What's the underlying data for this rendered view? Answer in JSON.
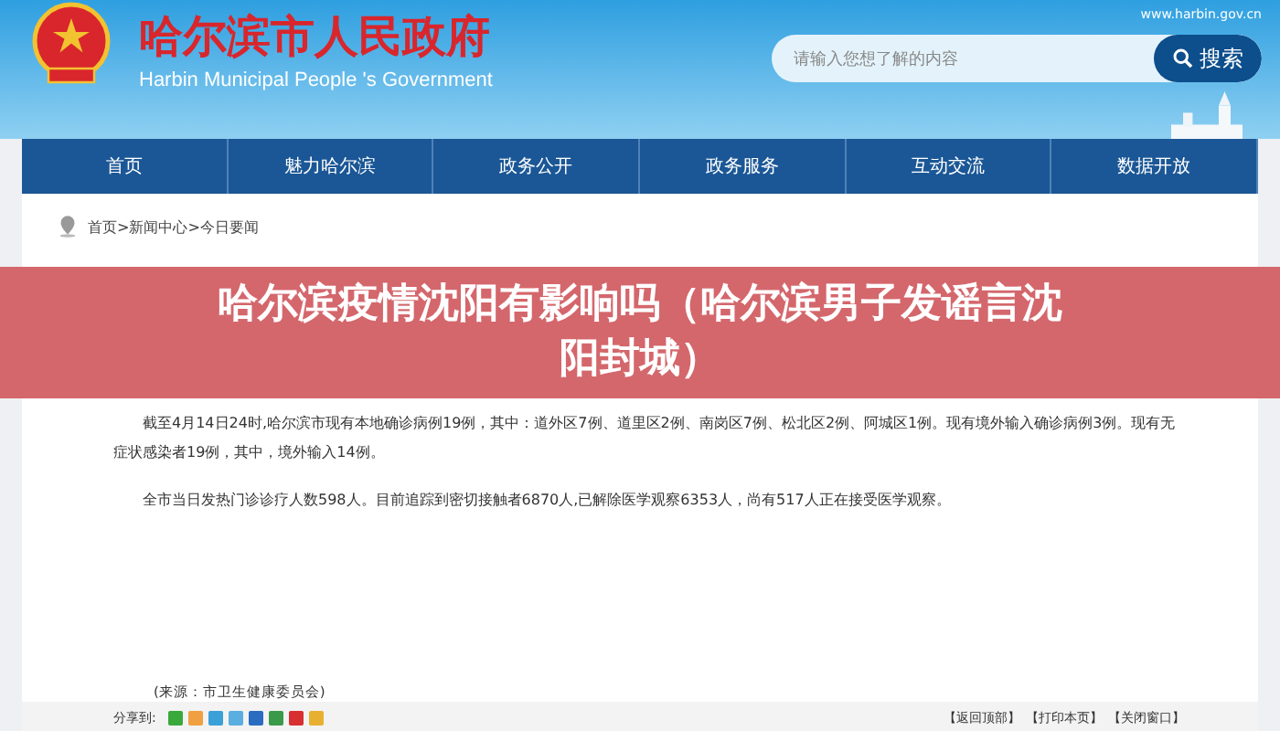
{
  "header": {
    "site_title": "哈尔滨市人民政府",
    "site_subtitle": "Harbin Municipal People 's Government",
    "domain": "www.harbin.gov.cn",
    "search": {
      "placeholder": "请输入您想了解的内容",
      "button": "搜索"
    }
  },
  "nav": [
    {
      "label": "首页"
    },
    {
      "label": "魅力哈尔滨"
    },
    {
      "label": "政务公开"
    },
    {
      "label": "政务服务"
    },
    {
      "label": "互动交流"
    },
    {
      "label": "数据开放"
    }
  ],
  "breadcrumb": "首页>新闻中心>今日要闻",
  "headline": "哈尔滨疫情沈阳有影响吗（哈尔滨男子发谣言沈阳封城）",
  "paragraphs": [
    "截至4月14日24时,哈尔滨市现有本地确诊病例19例，其中：道外区7例、道里区2例、南岗区7例、松北区2例、阿城区1例。现有境外输入确诊病例3例。现有无症状感染者19例，其中，境外输入14例。",
    "全市当日发热门诊诊疗人数598人。目前追踪到密切接触者6870人,已解除医学观察6353人，尚有517人正在接受医学观察。"
  ],
  "source": "(来源：市卫生健康委员会)",
  "share_label": "分享到:",
  "share_icons": [
    {
      "color": "#3aa83a"
    },
    {
      "color": "#f0a040"
    },
    {
      "color": "#3aa0d8"
    },
    {
      "color": "#5aaee0"
    },
    {
      "color": "#2a6cc0"
    },
    {
      "color": "#3a9a4a"
    },
    {
      "color": "#d83030"
    },
    {
      "color": "#e8b030"
    }
  ],
  "page_links": [
    "【返回顶部】",
    "【打印本页】",
    "【关闭窗口】"
  ]
}
